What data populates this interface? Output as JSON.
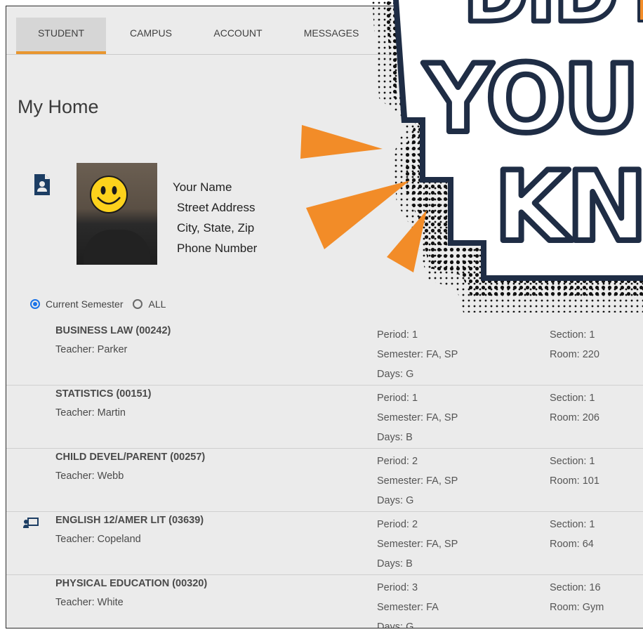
{
  "tabs": [
    {
      "label": "STUDENT",
      "active": true
    },
    {
      "label": "CAMPUS",
      "active": false
    },
    {
      "label": "ACCOUNT",
      "active": false
    },
    {
      "label": "MESSAGES",
      "active": false
    }
  ],
  "page_title": "My Home",
  "profile": {
    "name": "Your Name",
    "street": "Street Address",
    "city": "City, State, Zip",
    "phone": "Phone Number",
    "icon": "student-id-icon",
    "face_cover": "smiley-emoji"
  },
  "filter": {
    "options": [
      "Current Semester",
      "ALL"
    ],
    "selected": "Current Semester"
  },
  "courses": [
    {
      "name": "BUSINESS LAW (00242)",
      "teacher": "Teacher: Parker",
      "period": "Period: 1",
      "semester": "Semester: FA, SP",
      "days": "Days: G",
      "section": "Section: 1",
      "room": "Room: 220"
    },
    {
      "name": "STATISTICS (00151)",
      "teacher": "Teacher: Martin",
      "period": "Period: 1",
      "semester": "Semester: FA, SP",
      "days": "Days: B",
      "section": "Section: 1",
      "room": "Room: 206"
    },
    {
      "name": "CHILD DEVEL/PARENT (00257)",
      "teacher": "Teacher: Webb",
      "period": "Period: 2",
      "semester": "Semester: FA, SP",
      "days": "Days: G",
      "section": "Section: 1",
      "room": "Room: 101"
    },
    {
      "name": "ENGLISH 12/AMER LIT (03639)",
      "teacher": "Teacher: Copeland",
      "period": "Period: 2",
      "semester": "Semester: FA, SP",
      "days": "Days: B",
      "section": "Section: 1",
      "room": "Room: 64",
      "icon": "online-class-icon"
    },
    {
      "name": "PHYSICAL EDUCATION (00320)",
      "teacher": "Teacher: White",
      "period": "Period: 3",
      "semester": "Semester: FA",
      "days": "Days: G",
      "section": "Section: 16",
      "room": "Room: Gym"
    }
  ],
  "overlay": {
    "line1": "DID",
    "line1_accent": "Y",
    "line2": "YOU",
    "line3": "KN",
    "colors": {
      "outline": "#1f2d45",
      "accent": "#f28c28",
      "fill": "#ffffff",
      "arrow": "#f28c28"
    }
  },
  "colors": {
    "active_tab_underline": "#e8962f",
    "radio": "#1a73e8",
    "icon": "#1c3d63"
  }
}
